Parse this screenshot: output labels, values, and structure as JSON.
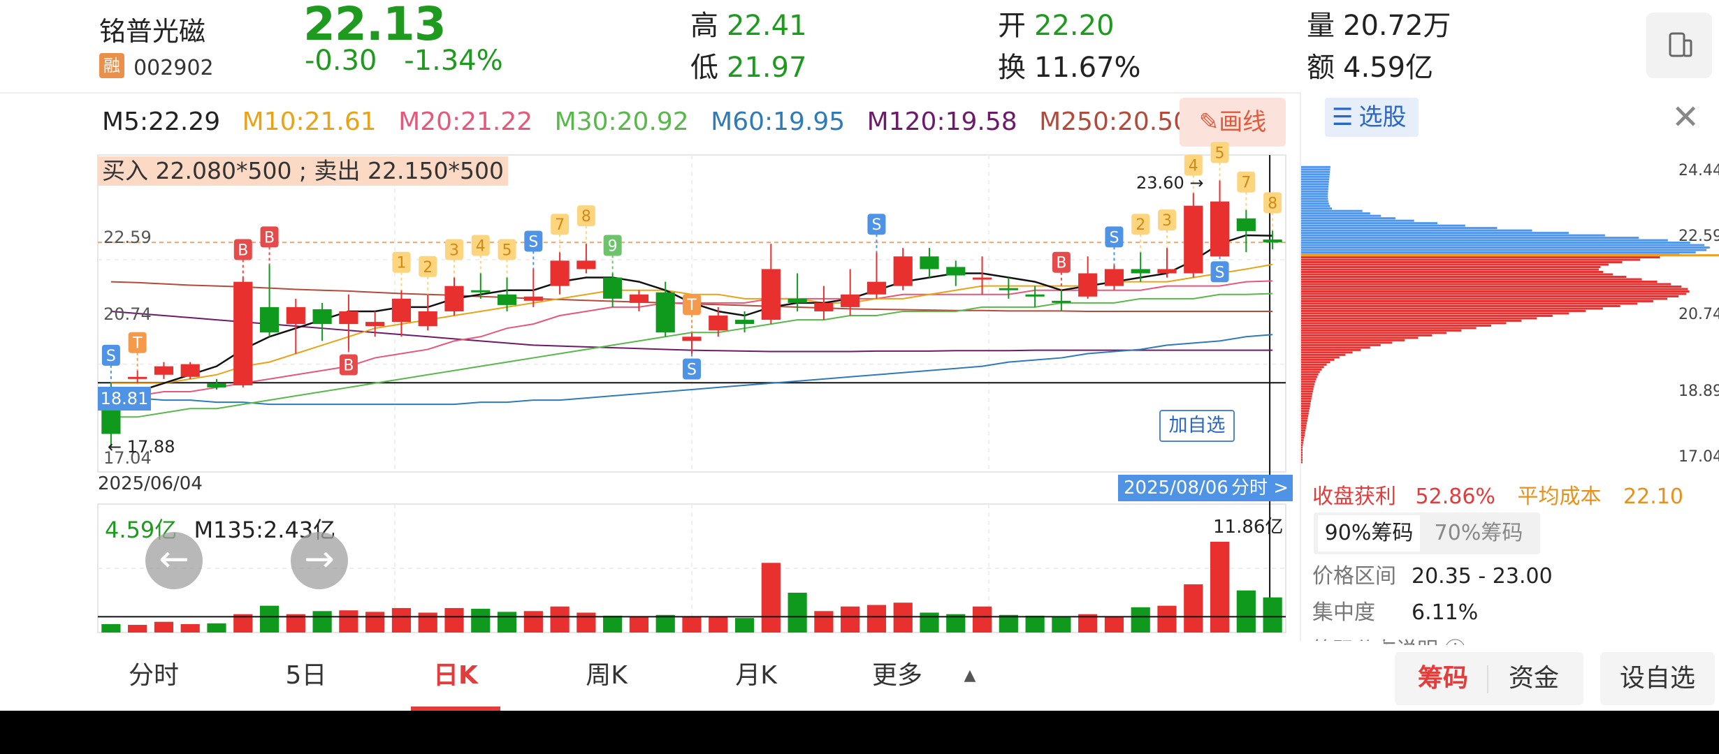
{
  "header": {
    "stock_name": "铭普光磁",
    "badge": "融",
    "stock_code": "002902",
    "price": "22.13",
    "change": "-0.30",
    "change_pct": "-1.34%",
    "high_label": "高",
    "high_value": "22.41",
    "low_label": "低",
    "low_value": "21.97",
    "open_label": "开",
    "open_value": "22.20",
    "turnover_label": "换",
    "turnover_value": "11.67%",
    "volume_label": "量",
    "volume_value": "20.72万",
    "amount_label": "额",
    "amount_value": "4.59亿"
  },
  "ma": {
    "m5": "M5:22.29",
    "m10": "M10:21.61",
    "m20": "M20:21.22",
    "m30": "M30:20.92",
    "m60": "M60:19.95",
    "m120": "M120:19.58",
    "m250": "M250:20.50"
  },
  "ma_colors": {
    "m5": "#222222",
    "m10": "#e8a317",
    "m20": "#e6587a",
    "m30": "#58b84a",
    "m60": "#2f7ab8",
    "m120": "#6d1a6a",
    "m250": "#b5493a"
  },
  "draw_button": "画线",
  "bid_ask": "买入 22.080*500 ; 卖出 22.150*500",
  "chart": {
    "y_label_top": "22.59",
    "y_label_mid": "20.74",
    "y_label_low": "17.04",
    "crosshair_price": "18.81",
    "high_mark": "23.60",
    "low_mark": "17.88",
    "start_date": "2025/06/04",
    "cursor_date": "2025/08/06",
    "fenshi_link": "分时 >",
    "add_watchlist": "加自选"
  },
  "volume": {
    "amount": "4.59亿",
    "m135": "M135:2.43亿",
    "max_label": "11.86亿"
  },
  "chart_data": {
    "type": "candlestick",
    "title": "",
    "ylim": [
      17.04,
      24.44
    ],
    "candles": [
      {
        "o": 18.2,
        "c": 17.6,
        "h": 18.8,
        "l": 17.3
      },
      {
        "o": 18.9,
        "c": 18.95,
        "h": 19.1,
        "l": 18.8
      },
      {
        "o": 19.0,
        "c": 19.2,
        "h": 19.3,
        "l": 18.9
      },
      {
        "o": 18.95,
        "c": 19.25,
        "h": 19.3,
        "l": 18.9
      },
      {
        "o": 18.8,
        "c": 18.7,
        "h": 18.9,
        "l": 18.65
      },
      {
        "o": 18.75,
        "c": 21.2,
        "h": 21.3,
        "l": 18.7
      },
      {
        "o": 20.6,
        "c": 20.0,
        "h": 21.6,
        "l": 19.9
      },
      {
        "o": 20.2,
        "c": 20.6,
        "h": 20.8,
        "l": 19.5
      },
      {
        "o": 20.55,
        "c": 20.2,
        "h": 20.7,
        "l": 19.8
      },
      {
        "o": 20.2,
        "c": 20.5,
        "h": 20.9,
        "l": 19.6
      },
      {
        "o": 20.15,
        "c": 20.25,
        "h": 20.5,
        "l": 19.9
      },
      {
        "o": 20.25,
        "c": 20.8,
        "h": 21.0,
        "l": 19.9
      },
      {
        "o": 20.15,
        "c": 20.5,
        "h": 20.9,
        "l": 20.05
      },
      {
        "o": 20.5,
        "c": 21.1,
        "h": 21.3,
        "l": 20.4
      },
      {
        "o": 21.0,
        "c": 20.95,
        "h": 21.4,
        "l": 20.8
      },
      {
        "o": 20.9,
        "c": 20.65,
        "h": 21.3,
        "l": 20.5
      },
      {
        "o": 20.75,
        "c": 20.85,
        "h": 21.5,
        "l": 20.6
      },
      {
        "o": 21.1,
        "c": 21.7,
        "h": 21.9,
        "l": 20.9
      },
      {
        "o": 21.5,
        "c": 21.7,
        "h": 22.1,
        "l": 21.4
      },
      {
        "o": 21.3,
        "c": 20.8,
        "h": 21.4,
        "l": 20.6
      },
      {
        "o": 20.7,
        "c": 20.9,
        "h": 21.0,
        "l": 20.5
      },
      {
        "o": 20.95,
        "c": 20.0,
        "h": 21.2,
        "l": 19.9
      },
      {
        "o": 19.8,
        "c": 19.9,
        "h": 20.0,
        "l": 19.5
      },
      {
        "o": 20.05,
        "c": 20.4,
        "h": 20.6,
        "l": 19.9
      },
      {
        "o": 20.3,
        "c": 20.2,
        "h": 20.5,
        "l": 20.0
      },
      {
        "o": 20.3,
        "c": 21.5,
        "h": 22.1,
        "l": 20.2
      },
      {
        "o": 20.8,
        "c": 20.7,
        "h": 21.4,
        "l": 20.5
      },
      {
        "o": 20.5,
        "c": 20.7,
        "h": 21.1,
        "l": 20.3
      },
      {
        "o": 20.6,
        "c": 20.9,
        "h": 21.5,
        "l": 20.4
      },
      {
        "o": 20.9,
        "c": 21.2,
        "h": 21.9,
        "l": 20.8
      },
      {
        "o": 21.1,
        "c": 21.8,
        "h": 22.0,
        "l": 21.0
      },
      {
        "o": 21.8,
        "c": 21.5,
        "h": 22.0,
        "l": 21.3
      },
      {
        "o": 21.55,
        "c": 21.35,
        "h": 21.7,
        "l": 21.1
      },
      {
        "o": 21.3,
        "c": 21.3,
        "h": 21.8,
        "l": 20.9
      },
      {
        "o": 21.05,
        "c": 21.0,
        "h": 21.3,
        "l": 20.8
      },
      {
        "o": 20.9,
        "c": 20.85,
        "h": 21.1,
        "l": 20.6
      },
      {
        "o": 20.75,
        "c": 20.7,
        "h": 21.0,
        "l": 20.5
      },
      {
        "o": 20.85,
        "c": 21.4,
        "h": 21.8,
        "l": 20.8
      },
      {
        "o": 21.1,
        "c": 21.5,
        "h": 21.6,
        "l": 21.0
      },
      {
        "o": 21.5,
        "c": 21.4,
        "h": 21.9,
        "l": 21.2
      },
      {
        "o": 21.4,
        "c": 21.5,
        "h": 22.0,
        "l": 21.3
      },
      {
        "o": 21.4,
        "c": 23.0,
        "h": 23.3,
        "l": 21.3
      },
      {
        "o": 21.8,
        "c": 23.1,
        "h": 23.6,
        "l": 21.8
      },
      {
        "o": 22.7,
        "c": 22.4,
        "h": 22.9,
        "l": 21.9
      },
      {
        "o": 22.2,
        "c": 22.13,
        "h": 22.41,
        "l": 21.97
      }
    ],
    "volume_yi": [
      1.1,
      1.0,
      1.4,
      1.1,
      1.2,
      2.4,
      3.5,
      2.4,
      2.8,
      2.9,
      2.7,
      3.2,
      2.6,
      3.2,
      3.1,
      2.7,
      2.8,
      3.4,
      2.6,
      2.2,
      2.1,
      2.3,
      2.1,
      2.0,
      1.9,
      9.1,
      5.2,
      2.8,
      3.4,
      3.6,
      3.9,
      2.6,
      2.4,
      3.4,
      2.3,
      2.2,
      2.0,
      2.4,
      2.0,
      3.3,
      3.5,
      6.3,
      11.86,
      5.5,
      4.59
    ],
    "ma5": [
      18.5,
      18.6,
      18.8,
      19.0,
      19.2,
      19.6,
      19.9,
      20.1,
      20.3,
      20.5,
      20.5,
      20.6,
      20.6,
      20.8,
      20.9,
      21.0,
      21.0,
      21.2,
      21.3,
      21.3,
      21.2,
      21.0,
      20.7,
      20.5,
      20.4,
      20.6,
      20.7,
      20.7,
      20.8,
      21.0,
      21.2,
      21.3,
      21.4,
      21.4,
      21.3,
      21.2,
      21.0,
      21.1,
      21.2,
      21.3,
      21.4,
      21.7,
      22.1,
      22.3,
      22.29
    ],
    "ma10": [
      18.8,
      18.8,
      18.8,
      18.9,
      19.0,
      19.2,
      19.3,
      19.5,
      19.7,
      19.9,
      20.1,
      20.2,
      20.3,
      20.4,
      20.5,
      20.6,
      20.7,
      20.8,
      20.9,
      21.0,
      21.0,
      21.0,
      20.9,
      20.9,
      20.8,
      20.8,
      20.8,
      20.7,
      20.7,
      20.8,
      20.8,
      20.9,
      21.0,
      21.1,
      21.1,
      21.1,
      21.1,
      21.1,
      21.2,
      21.2,
      21.2,
      21.3,
      21.4,
      21.5,
      21.61
    ],
    "ma20": [
      18.5,
      18.5,
      18.6,
      18.6,
      18.7,
      18.8,
      18.9,
      19.0,
      19.1,
      19.2,
      19.4,
      19.5,
      19.6,
      19.8,
      19.9,
      20.1,
      20.2,
      20.4,
      20.5,
      20.6,
      20.6,
      20.7,
      20.7,
      20.7,
      20.7,
      20.8,
      20.8,
      20.8,
      20.8,
      20.8,
      20.9,
      20.9,
      20.9,
      20.9,
      20.9,
      21.0,
      21.0,
      21.0,
      21.0,
      21.0,
      21.1,
      21.1,
      21.1,
      21.2,
      21.22
    ],
    "ma30": [
      18.0,
      18.0,
      18.1,
      18.2,
      18.2,
      18.3,
      18.4,
      18.5,
      18.6,
      18.7,
      18.8,
      18.9,
      19.0,
      19.1,
      19.2,
      19.3,
      19.4,
      19.5,
      19.6,
      19.7,
      19.8,
      19.9,
      20.0,
      20.0,
      20.1,
      20.2,
      20.3,
      20.3,
      20.4,
      20.4,
      20.5,
      20.5,
      20.5,
      20.6,
      20.6,
      20.6,
      20.7,
      20.7,
      20.7,
      20.8,
      20.8,
      20.8,
      20.9,
      20.9,
      20.92
    ],
    "ma60": [
      18.5,
      18.45,
      18.4,
      18.4,
      18.35,
      18.35,
      18.3,
      18.3,
      18.3,
      18.3,
      18.3,
      18.3,
      18.3,
      18.3,
      18.35,
      18.35,
      18.4,
      18.4,
      18.45,
      18.5,
      18.55,
      18.6,
      18.65,
      18.7,
      18.75,
      18.8,
      18.85,
      18.9,
      18.95,
      19.0,
      19.05,
      19.1,
      19.15,
      19.2,
      19.3,
      19.35,
      19.4,
      19.5,
      19.55,
      19.6,
      19.7,
      19.75,
      19.8,
      19.9,
      19.95
    ],
    "ma120": [
      20.5,
      20.45,
      20.4,
      20.35,
      20.3,
      20.25,
      20.2,
      20.15,
      20.1,
      20.05,
      20.0,
      19.95,
      19.9,
      19.85,
      19.8,
      19.75,
      19.7,
      19.68,
      19.66,
      19.64,
      19.62,
      19.6,
      19.58,
      19.57,
      19.56,
      19.55,
      19.55,
      19.55,
      19.55,
      19.56,
      19.56,
      19.56,
      19.57,
      19.57,
      19.57,
      19.58,
      19.58,
      19.58,
      19.58,
      19.58,
      19.58,
      19.58,
      19.58,
      19.58,
      19.58
    ],
    "ma250": [
      21.2,
      21.18,
      21.15,
      21.12,
      21.1,
      21.08,
      21.05,
      21.02,
      21.0,
      20.98,
      20.95,
      20.92,
      20.9,
      20.88,
      20.85,
      20.83,
      20.8,
      20.78,
      20.76,
      20.74,
      20.72,
      20.7,
      20.68,
      20.66,
      20.64,
      20.62,
      20.6,
      20.58,
      20.56,
      20.55,
      20.54,
      20.53,
      20.52,
      20.52,
      20.51,
      20.51,
      20.51,
      20.5,
      20.5,
      20.5,
      20.5,
      20.5,
      20.5,
      20.5,
      20.5
    ]
  },
  "markers": [
    {
      "i": 0,
      "label": "S",
      "color": "#4f93e6",
      "pos": "above"
    },
    {
      "i": 1,
      "label": "T",
      "color": "#f49a4a",
      "pos": "above"
    },
    {
      "i": 5,
      "label": "B",
      "color": "#e54b4b",
      "pos": "above"
    },
    {
      "i": 6,
      "label": "B",
      "color": "#e54b4b",
      "pos": "above"
    },
    {
      "i": 9,
      "label": "B",
      "color": "#e54b4b",
      "pos": "below"
    },
    {
      "i": 11,
      "label": "1",
      "color": "#fdd57e",
      "pos": "above"
    },
    {
      "i": 12,
      "label": "2",
      "color": "#fdd57e",
      "pos": "above"
    },
    {
      "i": 13,
      "label": "3",
      "color": "#fdd57e",
      "pos": "above"
    },
    {
      "i": 14,
      "label": "4",
      "color": "#fdd57e",
      "pos": "above"
    },
    {
      "i": 15,
      "label": "5",
      "color": "#fdd57e",
      "pos": "above"
    },
    {
      "i": 16,
      "label": "S",
      "color": "#4f93e6",
      "pos": "above"
    },
    {
      "i": 17,
      "label": "7",
      "color": "#fdd57e",
      "pos": "above"
    },
    {
      "i": 18,
      "label": "8",
      "color": "#fdd57e",
      "pos": "above"
    },
    {
      "i": 19,
      "label": "9",
      "color": "#6cc36c",
      "pos": "above"
    },
    {
      "i": 22,
      "label": "T",
      "color": "#f49a4a",
      "pos": "above"
    },
    {
      "i": 22,
      "label": "S",
      "color": "#4f93e6",
      "pos": "below"
    },
    {
      "i": 29,
      "label": "S",
      "color": "#4f93e6",
      "pos": "above"
    },
    {
      "i": 36,
      "label": "B",
      "color": "#e54b4b",
      "pos": "above"
    },
    {
      "i": 38,
      "label": "S",
      "color": "#4f93e6",
      "pos": "above"
    },
    {
      "i": 39,
      "label": "2",
      "color": "#fdd57e",
      "pos": "above"
    },
    {
      "i": 40,
      "label": "3",
      "color": "#fdd57e",
      "pos": "above"
    },
    {
      "i": 41,
      "label": "4",
      "color": "#fdd57e",
      "pos": "above"
    },
    {
      "i": 42,
      "label": "5",
      "color": "#fdd57e",
      "pos": "above"
    },
    {
      "i": 42,
      "label": "S",
      "color": "#4f93e6",
      "pos": "below"
    },
    {
      "i": 43,
      "label": "7",
      "color": "#fdd57e",
      "pos": "above"
    },
    {
      "i": 44,
      "label": "8",
      "color": "#fdd57e",
      "pos": "above"
    }
  ],
  "tabs": [
    "分时",
    "5日",
    "日K",
    "周K",
    "月K",
    "更多"
  ],
  "active_tab": "日K",
  "right_buttons": {
    "chips": "筹码",
    "funds": "资金",
    "add_watch": "设自选"
  },
  "chip_panel": {
    "select_stock": "选股",
    "prices": [
      "24.44",
      "22.59",
      "20.74",
      "18.89",
      "17.04"
    ],
    "profit_label": "收盘获利",
    "profit_value": "52.86%",
    "avg_label": "平均成本",
    "avg_value": "22.10",
    "tab90": "90%筹码",
    "tab70": "70%筹码",
    "range_label": "价格区间",
    "range_value": "20.35 - 23.00",
    "conc_label": "集中度",
    "conc_value": "6.11%",
    "explain_label": "筹码分布说明"
  }
}
